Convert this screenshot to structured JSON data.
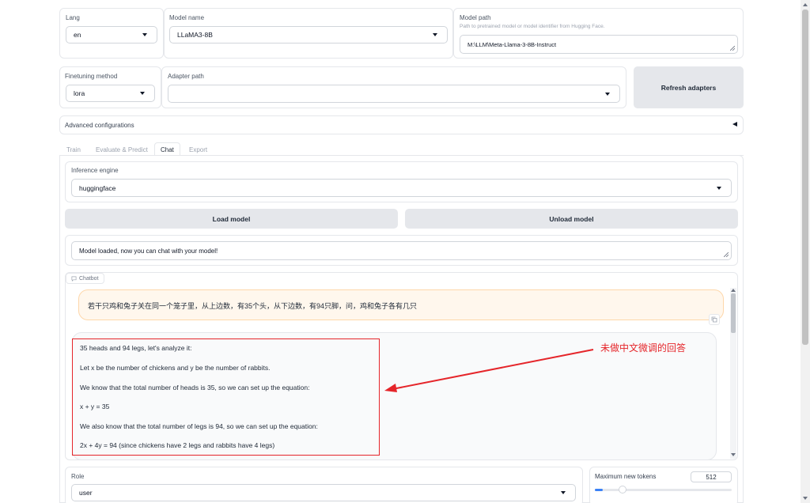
{
  "top": {
    "lang": {
      "label": "Lang",
      "value": "en"
    },
    "model_name": {
      "label": "Model name",
      "value": "LLaMA3-8B"
    },
    "model_path": {
      "label": "Model path",
      "hint": "Path to pretrained model or model identifier from Hugging Face.",
      "value": "M:\\LLM\\Meta-Llama-3-8B-Instruct"
    }
  },
  "finetune": {
    "method": {
      "label": "Finetuning method",
      "value": "lora"
    },
    "adapter": {
      "label": "Adapter path",
      "value": ""
    },
    "refresh_label": "Refresh adapters"
  },
  "advanced": {
    "label": "Advanced configurations"
  },
  "tabs": [
    {
      "label": "Train",
      "active": false
    },
    {
      "label": "Evaluate & Predict",
      "active": false
    },
    {
      "label": "Chat",
      "active": true
    },
    {
      "label": "Export",
      "active": false
    }
  ],
  "chat": {
    "engine": {
      "label": "Inference engine",
      "value": "huggingface"
    },
    "load_label": "Load model",
    "unload_label": "Unload model",
    "status": "Model loaded, now you can chat with your model!",
    "chatbot_label": "Chatbot",
    "user_message": "若干只鸡和兔子关在同一个笼子里，从上边数，有35个头，从下边数，有94只脚，问，鸡和兔子各有几只",
    "bot_lines": [
      "35 heads and 94 legs, let's analyze it:",
      "Let x be the number of chickens and y be the number of rabbits.",
      "We know that the total number of heads is 35, so we can set up the equation:",
      "x + y = 35",
      "We also know that the total number of legs is 94, so we can set up the equation:",
      "2x + 4y = 94 (since chickens have 2 legs and rabbits have 4 legs)"
    ],
    "annotation": "未做中文微调的回答",
    "annotation_color": "#e5252a"
  },
  "bottom": {
    "role": {
      "label": "Role",
      "value": "user"
    },
    "max_tokens": {
      "label": "Maximum new tokens",
      "value": "512",
      "fraction": 0.06
    }
  },
  "colors": {
    "accent": "#3b82f6",
    "user_bubble": "#fff7ed",
    "user_border": "#fed7aa"
  }
}
